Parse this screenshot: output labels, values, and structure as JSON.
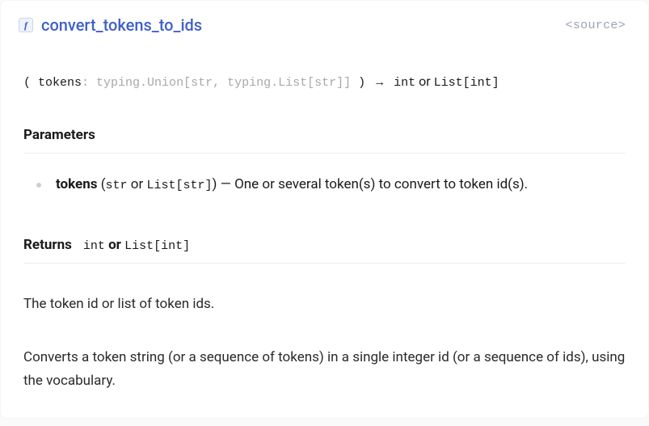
{
  "header": {
    "icon_glyph": "f",
    "method_name": "convert_tokens_to_ids",
    "source_label": "<source>"
  },
  "signature": {
    "open": "( ",
    "param_name": "tokens",
    "colon": ": ",
    "type_hint": "typing.Union[str, typing.List[str]]",
    "close": " )",
    "arrow": "→",
    "return_part1": "int",
    "return_or": " or ",
    "return_part2": "List[int]"
  },
  "parameters_title": "Parameters",
  "params": [
    {
      "name": "tokens",
      "type_a": "str",
      "or": " or ",
      "type_b": "List[str]",
      "dash": ") — ",
      "desc": "One or several token(s) to convert to token id(s)."
    }
  ],
  "returns": {
    "label": "Returns",
    "type_a": "int",
    "or": " or ",
    "type_b": "List[int]"
  },
  "return_desc": "The token id or list of token ids.",
  "description": "Converts a token string (or a sequence of tokens) in a single integer id (or a sequence of ids), using the vocabulary."
}
